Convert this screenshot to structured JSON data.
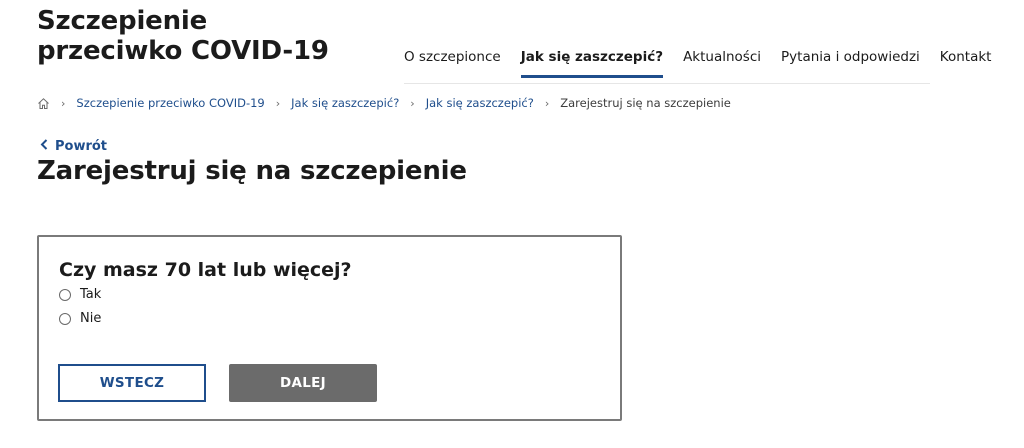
{
  "header": {
    "site_title": "Szczepienie przeciwko COVID-19"
  },
  "nav": {
    "items": [
      {
        "label": "O szczepionce",
        "active": false
      },
      {
        "label": "Jak się zaszczepić?",
        "active": true
      },
      {
        "label": "Aktualności",
        "active": false
      },
      {
        "label": "Pytania i odpowiedzi",
        "active": false
      },
      {
        "label": "Kontakt",
        "active": false
      }
    ]
  },
  "breadcrumb": {
    "home_icon": "home-icon",
    "items": [
      "Szczepienie przeciwko COVID-19",
      "Jak się zaszczepić?",
      "Jak się zaszczepić?",
      "Zarejestruj się na szczepienie"
    ]
  },
  "back_link": {
    "label": "Powrót",
    "icon": "chevron-left-icon"
  },
  "page_title": "Zarejestruj się na szczepienie",
  "form": {
    "question": "Czy masz 70 lat lub więcej?",
    "options": [
      "Tak",
      "Nie"
    ],
    "selected": null,
    "back_button": "WSTECZ",
    "next_button": "DALEJ"
  },
  "colors": {
    "accent": "#1f4e8c",
    "disabled_button": "#6b6b6b",
    "card_border": "#7a7a7a"
  }
}
